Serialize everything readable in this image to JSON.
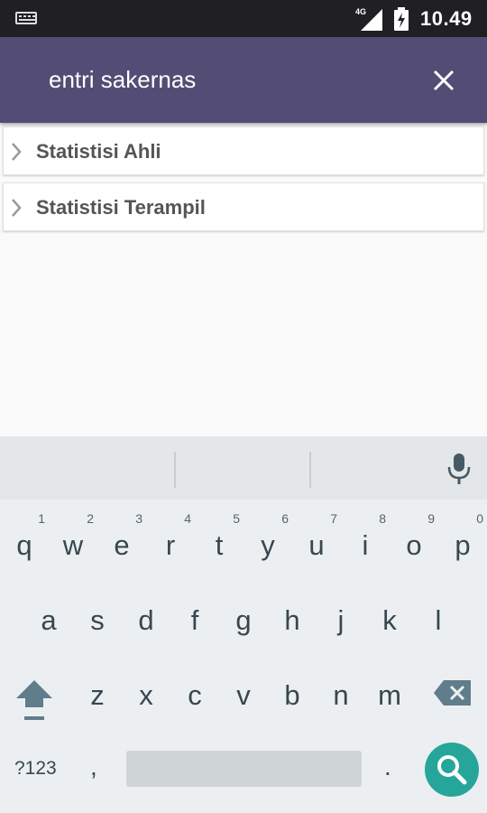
{
  "status_bar": {
    "network": "4G",
    "time": "10.49",
    "icons": [
      "keyboard-icon",
      "signal-icon",
      "battery-charging-icon"
    ]
  },
  "search": {
    "query": "entri sakernas",
    "close_icon": "close-icon"
  },
  "results": [
    {
      "label": "Statistisi Ahli"
    },
    {
      "label": "Statistisi Terampil"
    }
  ],
  "keyboard": {
    "row1": [
      {
        "key": "q",
        "num": "1"
      },
      {
        "key": "w",
        "num": "2"
      },
      {
        "key": "e",
        "num": "3"
      },
      {
        "key": "r",
        "num": "4"
      },
      {
        "key": "t",
        "num": "5"
      },
      {
        "key": "y",
        "num": "6"
      },
      {
        "key": "u",
        "num": "7"
      },
      {
        "key": "i",
        "num": "8"
      },
      {
        "key": "o",
        "num": "9"
      },
      {
        "key": "p",
        "num": "0"
      }
    ],
    "row2": [
      "a",
      "s",
      "d",
      "f",
      "g",
      "h",
      "j",
      "k",
      "l"
    ],
    "row3": [
      "z",
      "x",
      "c",
      "v",
      "b",
      "n",
      "m"
    ],
    "symbols_label": "?123",
    "comma": ",",
    "period": ".",
    "accent_color": "#26a69a",
    "icons": [
      "mic-icon",
      "shift-icon",
      "backspace-icon",
      "search-icon"
    ]
  }
}
